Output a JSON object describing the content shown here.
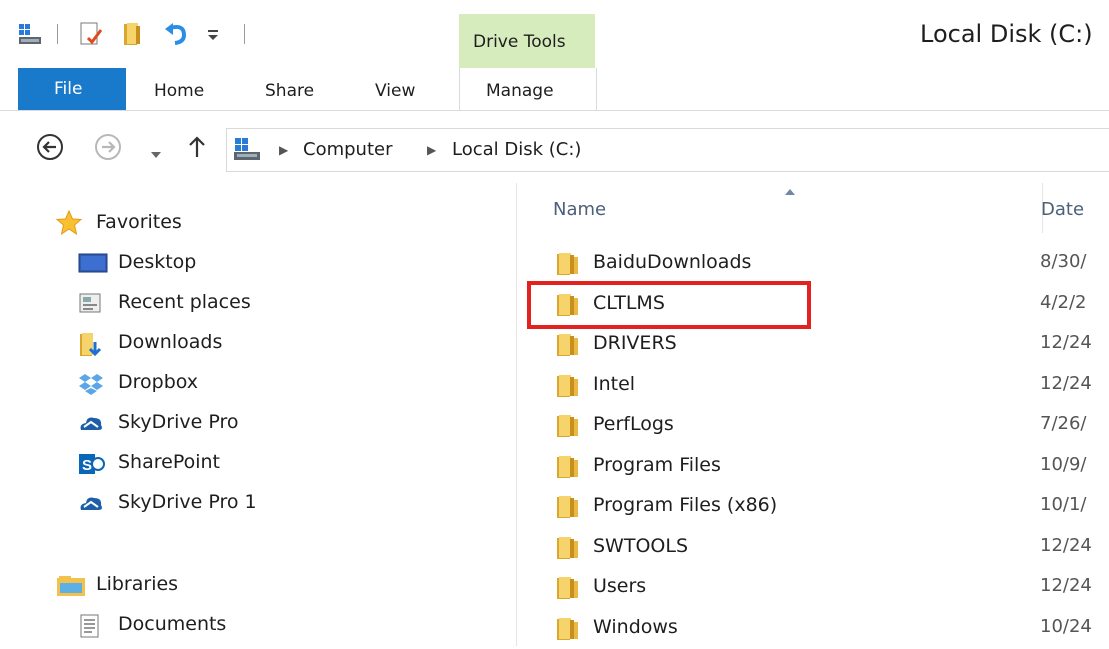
{
  "window": {
    "title": "Local Disk (C:)",
    "contextual_tab_group": "Drive Tools"
  },
  "quick_access": {
    "icons": [
      "drive-icon",
      "properties-icon",
      "new-folder-icon",
      "undo-icon",
      "customize-dropdown-icon"
    ]
  },
  "ribbon": {
    "tabs": [
      {
        "label": "File",
        "active": true
      },
      {
        "label": "Home"
      },
      {
        "label": "Share"
      },
      {
        "label": "View"
      },
      {
        "label": "Manage"
      }
    ]
  },
  "address_bar": {
    "crumbs": [
      "Computer",
      "Local Disk (C:)"
    ]
  },
  "nav_pane": {
    "favorites_header": "Favorites",
    "favorites": [
      {
        "label": "Desktop",
        "icon": "desktop-icon"
      },
      {
        "label": "Recent places",
        "icon": "recent-places-icon"
      },
      {
        "label": "Downloads",
        "icon": "downloads-icon"
      },
      {
        "label": "Dropbox",
        "icon": "dropbox-icon"
      },
      {
        "label": "SkyDrive Pro",
        "icon": "skydrive-icon"
      },
      {
        "label": "SharePoint",
        "icon": "sharepoint-icon"
      },
      {
        "label": "SkyDrive Pro 1",
        "icon": "skydrive-icon"
      }
    ],
    "libraries_header": "Libraries",
    "libraries": [
      {
        "label": "Documents",
        "icon": "documents-icon"
      }
    ]
  },
  "file_list": {
    "columns": {
      "name": "Name",
      "date": "Date"
    },
    "rows": [
      {
        "name": "BaiduDownloads",
        "date": "8/30/"
      },
      {
        "name": "CLTLMS",
        "date": "4/2/2",
        "highlighted": true
      },
      {
        "name": "DRIVERS",
        "date": "12/24"
      },
      {
        "name": "Intel",
        "date": "12/24"
      },
      {
        "name": "PerfLogs",
        "date": "7/26/"
      },
      {
        "name": "Program Files",
        "date": "10/9/"
      },
      {
        "name": "Program Files (x86)",
        "date": "10/1/"
      },
      {
        "name": "SWTOOLS",
        "date": "12/24"
      },
      {
        "name": "Users",
        "date": "12/24"
      },
      {
        "name": "Windows",
        "date": "10/24"
      }
    ]
  },
  "colors": {
    "file_tab": "#1979ca",
    "drive_tools": "#d6ecbd",
    "highlight": "#e3211e",
    "folder": "#f4c54c"
  }
}
